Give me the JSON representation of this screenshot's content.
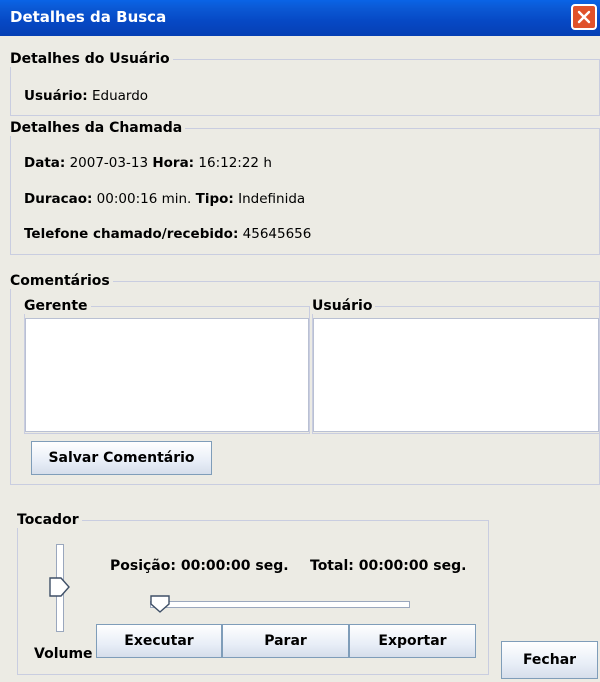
{
  "window": {
    "title": "Detalhes da Busca"
  },
  "user_details": {
    "legend": "Detalhes do Usuário",
    "user_label": "Usuário:",
    "user_value": "Eduardo"
  },
  "call_details": {
    "legend": "Detalhes da Chamada",
    "date_label": "Data:",
    "date_value": "2007-03-13",
    "time_label": "Hora:",
    "time_value": "16:12:22 h",
    "duration_label": "Duracao:",
    "duration_value": "00:00:16 min.",
    "type_label": "Tipo:",
    "type_value": "Indefinida",
    "phone_label": "Telefone chamado/recebido:",
    "phone_value": "45645656"
  },
  "comments": {
    "legend": "Comentários",
    "manager_legend": "Gerente",
    "manager_text": "",
    "user_legend": "Usuário",
    "user_text": "",
    "save_label": "Salvar Comentário"
  },
  "player": {
    "legend": "Tocador",
    "position_text": "Posição:  00:00:00 seg.",
    "total_text": "Total:  00:00:00 seg.",
    "volume_label": "Volume",
    "volume_level": 0.5,
    "seek_position": 0.0,
    "play_label": "Executar",
    "stop_label": "Parar",
    "export_label": "Exportar"
  },
  "close_label": "Fechar"
}
